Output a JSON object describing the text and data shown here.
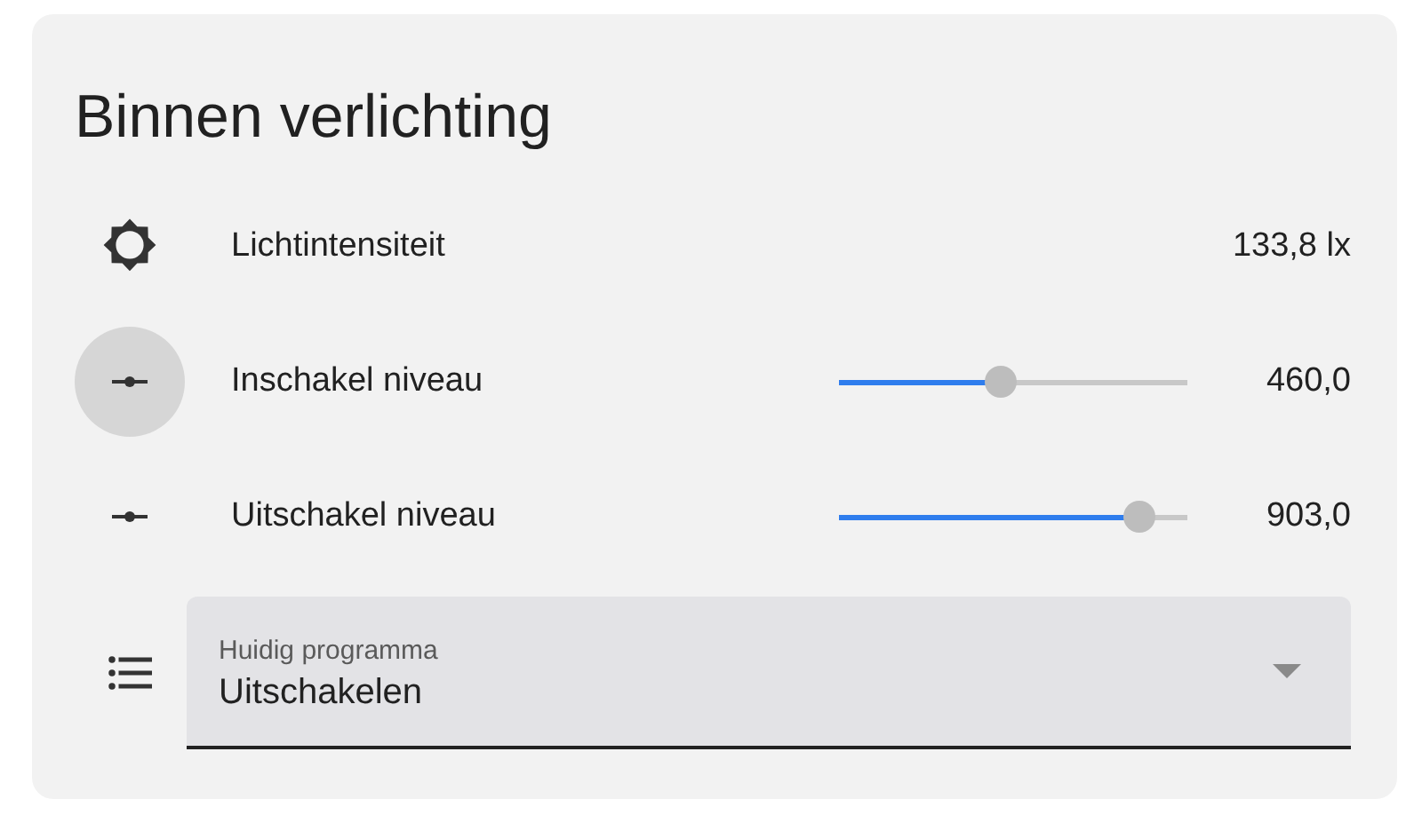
{
  "card": {
    "title": "Binnen verlichting",
    "rows": [
      {
        "kind": "sensor",
        "label": "Lichtintensiteit",
        "value": "133,8 lx",
        "highlighted": false
      },
      {
        "kind": "slider",
        "label": "Inschakel niveau",
        "level": 0.46,
        "value": "460,0",
        "highlighted": true
      },
      {
        "kind": "slider",
        "label": "Uitschakel niveau",
        "level": 0.9,
        "value": "903,0",
        "highlighted": false
      },
      {
        "kind": "select",
        "label": "Huidig programma",
        "value": "Uitschakelen",
        "highlighted": false
      }
    ]
  }
}
